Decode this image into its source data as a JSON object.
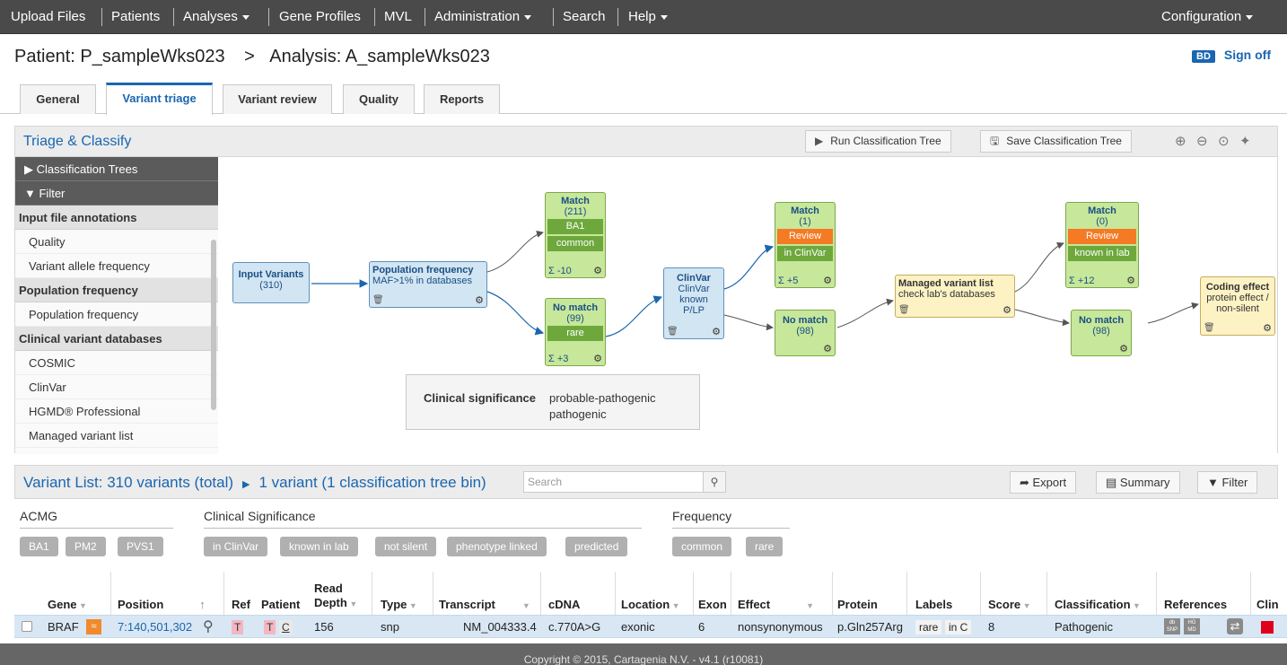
{
  "nav": {
    "items": [
      {
        "label": "Upload Files"
      },
      {
        "label": "Patients"
      },
      {
        "label": "Analyses",
        "dropdown": true
      },
      {
        "label": "Gene Profiles"
      },
      {
        "label": "MVL"
      },
      {
        "label": "Administration",
        "dropdown": true
      },
      {
        "label": "Search"
      },
      {
        "label": "Help",
        "dropdown": true
      }
    ],
    "config": "Configuration"
  },
  "breadcrumb": {
    "patient": "Patient: P_sampleWks023",
    "sep": ">",
    "analysis": "Analysis: A_sampleWks023"
  },
  "signoff": {
    "badge": "BD",
    "label": "Sign off"
  },
  "tabs": [
    "General",
    "Variant triage",
    "Variant review",
    "Quality",
    "Reports"
  ],
  "active_tab": "Variant triage",
  "triage": {
    "title": "Triage & Classify",
    "run": "Run Classification Tree",
    "save": "Save Classification Tree"
  },
  "sidebar": {
    "head1": "Classification Trees",
    "head2": "Filter",
    "g1": "Input file annotations",
    "i1": "Quality",
    "i2": "Variant allele frequency",
    "g2": "Population frequency",
    "i3": "Population frequency",
    "g3": "Clinical variant databases",
    "i4": "COSMIC",
    "i5": "ClinVar",
    "i6": "HGMD® Professional",
    "i7": "Managed variant list"
  },
  "tree": {
    "input": {
      "title": "Input Variants",
      "count": "(310)"
    },
    "pop": {
      "title": "Population frequency",
      "sub": "MAF>1% in databases"
    },
    "m1": {
      "title": "Match",
      "count": "(211)",
      "s1": "BA1",
      "s2": "common",
      "sigma": "Σ -10"
    },
    "nm1": {
      "title": "No match",
      "count": "(99)",
      "s1": "rare",
      "sigma": "Σ +3"
    },
    "clinvar": {
      "title": "ClinVar",
      "l1": "ClinVar",
      "l2": "known",
      "l3": "P/LP"
    },
    "m2": {
      "title": "Match",
      "count": "(1)",
      "s1": "Review",
      "s2": "in ClinVar",
      "sigma": "Σ +5"
    },
    "nm2": {
      "title": "No match",
      "count": "(98)"
    },
    "mvl": {
      "title": "Managed variant list",
      "sub": "check lab's databases"
    },
    "m3": {
      "title": "Match",
      "count": "(0)",
      "s1": "Review",
      "s2": "known in lab",
      "sigma": "Σ +12"
    },
    "nm3": {
      "title": "No match",
      "count": "(98)"
    },
    "coding": {
      "title": "Coding effect",
      "l1": "protein effect /",
      "l2": "non-silent"
    }
  },
  "tooltip": {
    "label": "Clinical significance",
    "v1": "probable-pathogenic",
    "v2": "pathogenic"
  },
  "variant_list": {
    "title": "Variant List: 310 variants (total)",
    "sub": "1 variant (1 classification tree bin)",
    "search_placeholder": "Search",
    "export": "Export",
    "summary": "Summary",
    "filter": "Filter"
  },
  "groups": {
    "acmg": "ACMG",
    "clin": "Clinical Significance",
    "freq": "Frequency"
  },
  "pills": {
    "acmg": [
      "BA1",
      "PM2",
      "PVS1"
    ],
    "clin": [
      "in ClinVar",
      "known in lab",
      "not silent",
      "phenotype linked",
      "predicted"
    ],
    "freq": [
      "common",
      "rare"
    ]
  },
  "columns": {
    "gene": "Gene",
    "position": "Position",
    "ref": "Ref",
    "patient": "Patient",
    "read": "Read",
    "depth": "Depth",
    "type": "Type",
    "transcript": "Transcript",
    "cdna": "cDNA",
    "location": "Location",
    "exon": "Exon",
    "effect": "Effect",
    "protein": "Protein",
    "labels": "Labels",
    "score": "Score",
    "classification": "Classification",
    "references": "References",
    "clin": "Clin"
  },
  "row": {
    "gene": "BRAF",
    "position": "7:140,501,302",
    "ref": "T",
    "pat1": "T",
    "pat2": "C",
    "depth": "156",
    "type": "snp",
    "transcript": "NM_004333.4",
    "cdna": "c.770A>G",
    "location": "exonic",
    "exon": "6",
    "effect": "nonsynonymous",
    "protein": "p.Gln257Arg",
    "label1": "rare",
    "label2": "in C",
    "score": "8",
    "classification": "Pathogenic",
    "ref1": "db SNP",
    "ref2": "HG MD"
  },
  "colors": {
    "accent": "#1a66b0",
    "nav": "#4a4a4a",
    "match": "#c7e79a",
    "review": "#f47a23",
    "pathogenic": "#e0001a"
  },
  "footer": "Copyright © 2015, Cartagenia N.V. - v4.1 (r10081)"
}
